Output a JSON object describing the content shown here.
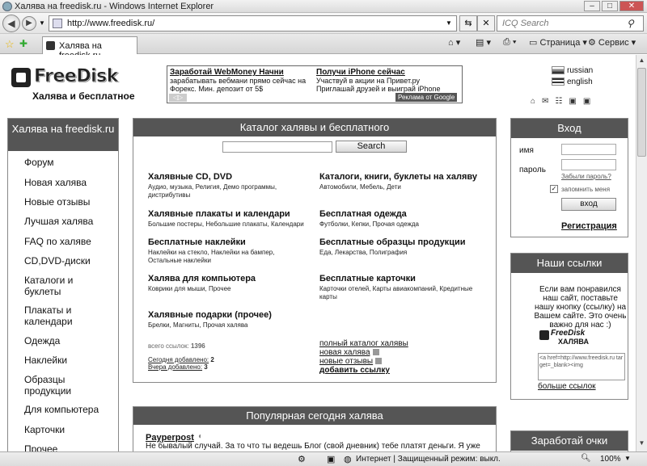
{
  "window": {
    "title": "Халява на freedisk.ru - Windows Internet Explorer"
  },
  "nav": {
    "url": "http://www.freedisk.ru/",
    "search_placeholder": "ICQ Search"
  },
  "tab": {
    "title": "Халява на freedisk.ru"
  },
  "toolbar": {
    "page_label": "Страница",
    "tools_label": "Сервис"
  },
  "site": {
    "logo_text": "FreeDisk",
    "tagline": "Халява и бесплатное"
  },
  "ad": {
    "left_title": "Заработай WebMoney Начни",
    "left_text1": "зарабатывать вебмани прямо сейчас на",
    "left_text2": "Форекс. Мин. депозит от 5$",
    "right_title": "Получи iPhone сейчас",
    "right_text1": "Участвуй в акции на Привет.ру",
    "right_text2": "Приглашай друзей и выиграй iPhone",
    "google": "Реклама от Google"
  },
  "langs": [
    "russian",
    "english"
  ],
  "left_box": {
    "title": "Халява на freedisk.ru",
    "items": [
      "Форум",
      "Новая халява",
      "Новые отзывы",
      "Лучшая халява",
      "FAQ по халяве",
      "CD,DVD-диски",
      "Каталоги и буклеты",
      "Плакаты и календари",
      "Одежда",
      "Наклейки",
      "Образцы продукции",
      "Для компьютера",
      "Карточки",
      "Прочее"
    ]
  },
  "catalog": {
    "title": "Каталог халявы и бесплатного",
    "search_button": "Search",
    "left": [
      {
        "title": "Халявные CD, DVD",
        "sub": "Аудио, музыка, Религия, Демо программы, дистрибутивы"
      },
      {
        "title": "Халявные плакаты и календари",
        "sub": "Большие постеры, Небольшие плакаты, Календари"
      },
      {
        "title": "Бесплатные наклейки",
        "sub": "Наклейки на стекло, Наклейки на бампер, Остальные наклейки"
      },
      {
        "title": "Халява для компьютера",
        "sub": "Коврики для мыши, Прочее"
      },
      {
        "title": "Халявные подарки (прочее)",
        "sub": "Брелки, Магниты, Прочая халява"
      }
    ],
    "right": [
      {
        "title": "Каталоги, книги, буклеты на халяву",
        "sub": "Автомобили, Мебель, Дети"
      },
      {
        "title": "Бесплатная одежда",
        "sub": "Футболки, Кепки, Прочая одежда"
      },
      {
        "title": "Бесплатные образцы продукции",
        "sub": "Еда, Лекарства, Полиграфия"
      },
      {
        "title": "Бесплатные карточки",
        "sub": "Карточки отелей, Карты авиакомпаний, Кредитные карты"
      }
    ],
    "total_label": "всего ссылок:",
    "total_value": "1396",
    "today_label": "Сегодня добавлено:",
    "today_value": "2",
    "yesterday_label": "Вчера добавлено:",
    "yesterday_value": "3",
    "links": [
      "полный каталог халявы",
      "новая халява",
      "новые отзывы",
      "добавить ссылку"
    ]
  },
  "popular": {
    "title": "Популярная сегодня халява",
    "item_title": "Payperpost",
    "item_text": "Не бывалый случай. За то что ты ведешь Блог (свой дневник) тебе платят деньги. Я уже"
  },
  "login": {
    "title": "Вход",
    "name_label": "имя",
    "pass_label": "пароль",
    "forgot": "Забыли пароль?",
    "remember": "запомнить меня",
    "button": "вход",
    "register": "Регистрация"
  },
  "links_box": {
    "title": "Наши ссылки",
    "text": "Если вам понравился наш сайт, поставьте нашу кнопку (ссылку) на Вашем сайте. Это очень важно для нас :)",
    "logo_text": "FreeDisk",
    "logo_sub": "ХАЛЯВА",
    "code": "<a href=http://www.freedisk.ru target=_blank><img",
    "more": "больше ссылок"
  },
  "earn_box": {
    "title": "Заработай очки"
  },
  "status": {
    "zone": "Интернет | Защищенный режим: выкл.",
    "zoom": "100%"
  }
}
